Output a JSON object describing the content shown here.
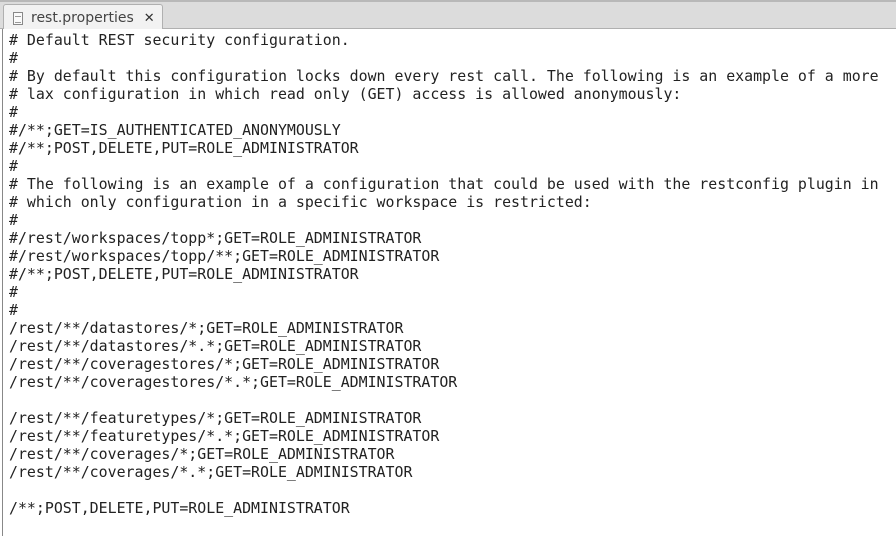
{
  "tab": {
    "title": "rest.properties",
    "icon": "file-icon",
    "close": "✕"
  },
  "lines": [
    "# Default REST security configuration.",
    "#",
    "# By default this configuration locks down every rest call. The following is an example of a more",
    "# lax configuration in which read only (GET) access is allowed anonymously:",
    "#",
    "#/**;GET=IS_AUTHENTICATED_ANONYMOUSLY",
    "#/**;POST,DELETE,PUT=ROLE_ADMINISTRATOR",
    "#",
    "# The following is an example of a configuration that could be used with the restconfig plugin in",
    "# which only configuration in a specific workspace is restricted:",
    "#",
    "#/rest/workspaces/topp*;GET=ROLE_ADMINISTRATOR",
    "#/rest/workspaces/topp/**;GET=ROLE_ADMINISTRATOR",
    "#/**;POST,DELETE,PUT=ROLE_ADMINISTRATOR",
    "#",
    "#",
    "/rest/**/datastores/*;GET=ROLE_ADMINISTRATOR",
    "/rest/**/datastores/*.*;GET=ROLE_ADMINISTRATOR",
    "/rest/**/coveragestores/*;GET=ROLE_ADMINISTRATOR",
    "/rest/**/coveragestores/*.*;GET=ROLE_ADMINISTRATOR",
    "",
    "/rest/**/featuretypes/*;GET=ROLE_ADMINISTRATOR",
    "/rest/**/featuretypes/*.*;GET=ROLE_ADMINISTRATOR",
    "/rest/**/coverages/*;GET=ROLE_ADMINISTRATOR",
    "/rest/**/coverages/*.*;GET=ROLE_ADMINISTRATOR",
    "",
    "/**;POST,DELETE,PUT=ROLE_ADMINISTRATOR"
  ]
}
